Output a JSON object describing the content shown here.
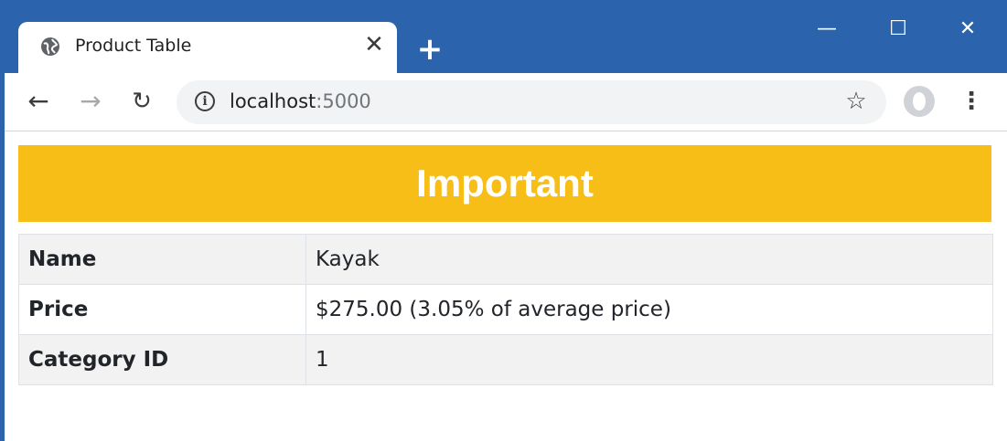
{
  "browser": {
    "tab": {
      "title": "Product Table",
      "close_glyph": "✕",
      "icon": "globe-icon"
    },
    "new_tab_glyph": "+",
    "window_controls": {
      "minimize": "—",
      "maximize": "☐",
      "close": "✕"
    },
    "toolbar": {
      "back_glyph": "←",
      "forward_glyph": "→",
      "reload_glyph": "↻",
      "info_glyph": "i",
      "url_host": "localhost",
      "url_port": ":5000",
      "star_glyph": "☆",
      "menu_glyph": "⋮"
    }
  },
  "page": {
    "banner": {
      "text": "Important",
      "color": "#f6be16"
    },
    "table": {
      "rows": [
        {
          "label": "Name",
          "value": "Kayak"
        },
        {
          "label": "Price",
          "value": "$275.00 (3.05% of average price)"
        },
        {
          "label": "Category ID",
          "value": "1"
        }
      ]
    }
  },
  "colors": {
    "chrome": "#2b64ad",
    "omnibox": "#f1f3f4",
    "stripe": "#f2f2f2"
  }
}
